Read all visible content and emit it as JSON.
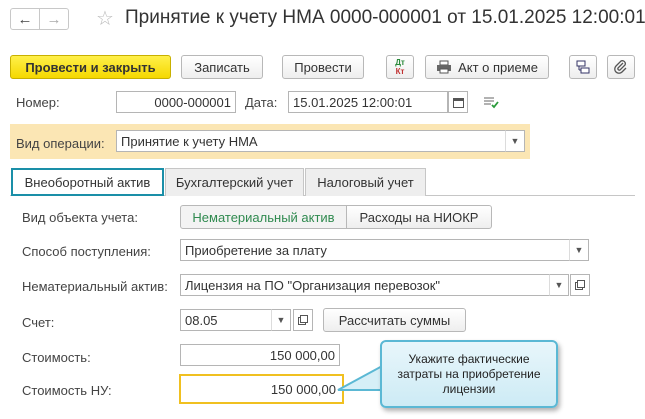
{
  "header": {
    "title": "Принятие к учету НМА 0000-000001 от 15.01.2025 12:00:01",
    "back_icon": "arrow-left-icon",
    "forward_icon": "arrow-right-icon",
    "favorite_icon": "star-icon"
  },
  "toolbar": {
    "post_close_label": "Провести и закрыть",
    "save_label": "Записать",
    "post_label": "Провести",
    "dt_kt_icon": "dt-kt-icon",
    "dt_label": "Дт",
    "kt_label": "Кт",
    "act_label": "Акт о приеме",
    "print_icon": "printer-icon",
    "struct_icon": "structure-icon",
    "attach_icon": "paperclip-icon"
  },
  "form": {
    "number_label": "Номер:",
    "number_value": "0000-000001",
    "date_label": "Дата:",
    "date_value": "15.01.2025 12:00:01",
    "operation_label": "Вид операции:",
    "operation_value": "Принятие к учету НМА"
  },
  "tabs": [
    {
      "label": "Внеоборотный актив",
      "active": true
    },
    {
      "label": "Бухгалтерский учет",
      "active": false
    },
    {
      "label": "Налоговый учет",
      "active": false
    }
  ],
  "panel": {
    "object_type_label": "Вид объекта учета:",
    "object_type_on": "Нематериальный актив",
    "object_type_off": "Расходы на НИОКР",
    "receipt_label": "Способ поступления:",
    "receipt_value": "Приобретение за плату",
    "asset_label": "Нематериальный актив:",
    "asset_value": "Лицензия на ПО \"Организация перевозок\"",
    "account_label": "Счет:",
    "account_value": "08.05",
    "calc_label": "Рассчитать суммы",
    "cost_label": "Стоимость:",
    "cost_value": "150 000,00",
    "cost_nu_label": "Стоимость НУ:",
    "cost_nu_value": "150 000,00"
  },
  "callout": {
    "text": "Укажите фактические затраты на приобретение лицензии"
  },
  "colors": {
    "primary_button": "#f5d800",
    "active_tab_border": "#1a8fa8",
    "highlight_row": "#fbe6b4",
    "focus_border": "#f0c020",
    "callout_border": "#5bb8d4",
    "segment_active_text": "#2f8a4f"
  }
}
